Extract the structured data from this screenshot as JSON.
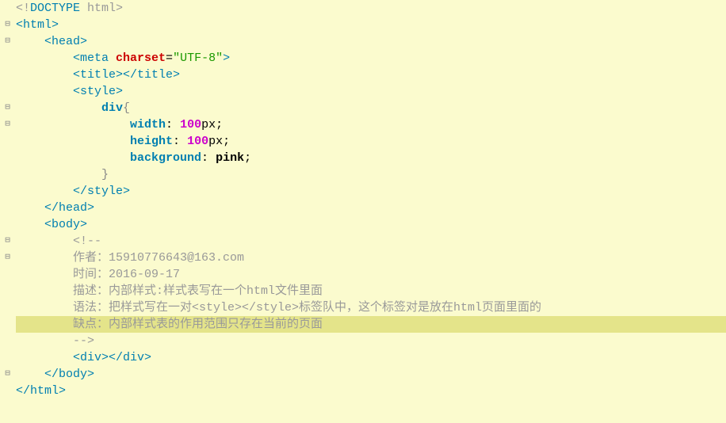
{
  "code": {
    "doctype_open": "<!",
    "doctype_kw": "DOCTYPE",
    "doctype_rest": " html>",
    "tag_html_open": "<html>",
    "tag_head_open": "<head>",
    "meta_open": "<meta ",
    "meta_attr": "charset",
    "meta_eq": "=",
    "meta_val": "\"UTF-8\"",
    "meta_close": ">",
    "title_open": "<title>",
    "title_close": "</title>",
    "style_open": "<style>",
    "css_sel": "div",
    "brace_open": "{",
    "prop_width": "width",
    "val_100": "100",
    "unit_px": "px",
    "semi": ";",
    "colon": ": ",
    "prop_height": "height",
    "prop_bg": "background",
    "val_pink": "pink",
    "brace_close": "}",
    "style_close": "</style>",
    "tag_head_close": "</head>",
    "tag_body_open": "<body>",
    "comment_open": "<!--",
    "c1": "作者：15910776643@163.com",
    "c2": "时间：2016-09-17",
    "c3": "描述：内部样式:样式表写在一个html文件里面",
    "c4": "语法：把样式写在一对<style></style>标签队中，这个标签对是放在html页面里面的",
    "c5": "缺点：内部样式表的作用范围只存在当前的页面",
    "comment_close": "-->",
    "div_open": "<div>",
    "div_close": "</div>",
    "tag_body_close": "</body>",
    "tag_html_close": "</html>"
  },
  "folds": [
    "⊟",
    "⊟",
    "⊟",
    "⊟",
    "⊟",
    "⊟",
    "⊟"
  ]
}
